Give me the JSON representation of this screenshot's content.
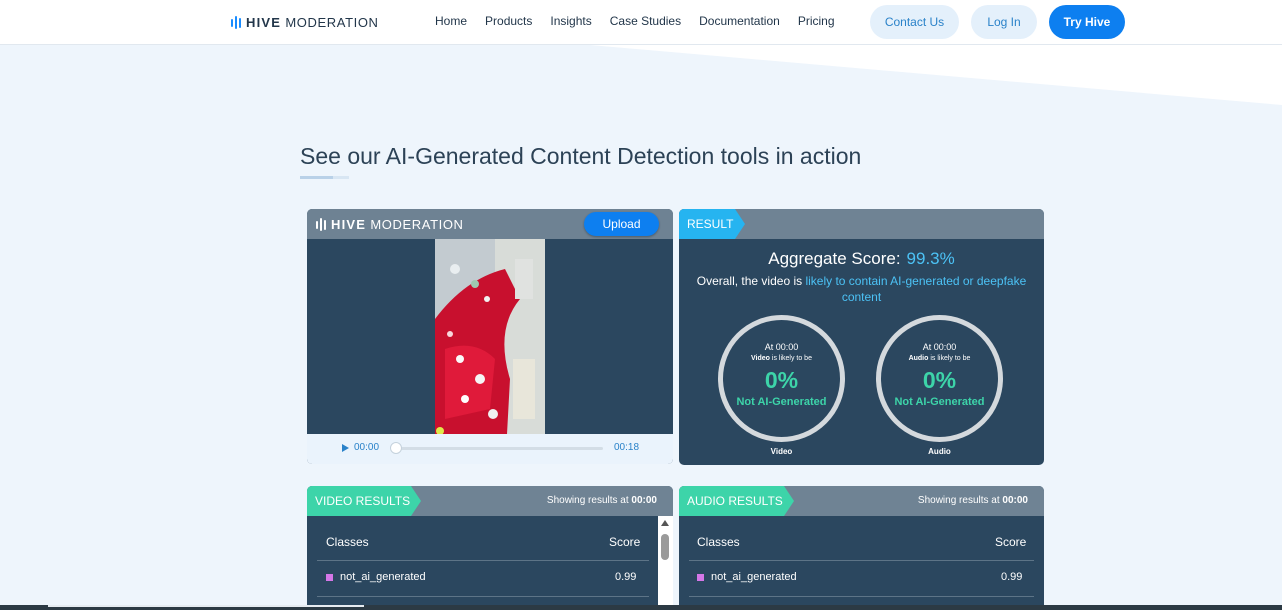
{
  "nav": {
    "logo_bold": "HIVE",
    "logo_light": "MODERATION",
    "links": [
      "Home",
      "Products",
      "Insights",
      "Case Studies",
      "Documentation",
      "Pricing"
    ],
    "contact_label": "Contact Us",
    "login_label": "Log In",
    "try_label": "Try Hive"
  },
  "section": {
    "heading": "See our AI-Generated Content Detection tools in action"
  },
  "player": {
    "logo_bold": "HIVE",
    "logo_light": "MODERATION",
    "upload_label": "Upload",
    "current_time": "00:00",
    "duration": "00:18",
    "progress": 0
  },
  "result": {
    "tag": "RESULT",
    "aggregate_label": "Aggregate Score:",
    "aggregate_value": "99.3%",
    "overall_prefix": "Overall, the video is ",
    "overall_highlight": "likely to contain AI-generated or deepfake content",
    "video_gauge": {
      "at": "At 00:00",
      "subject": "Video",
      "likely": " is likely to be",
      "percent": "0%",
      "verdict": "Not AI-Generated",
      "caption": "Video"
    },
    "audio_gauge": {
      "at": "At 00:00",
      "subject": "Audio",
      "likely": " is likely to be",
      "percent": "0%",
      "verdict": "Not AI-Generated",
      "caption": "Audio"
    }
  },
  "video_results": {
    "tag": "VIDEO RESULTS",
    "showing_prefix": "Showing results at ",
    "showing_time": "00:00",
    "col_classes": "Classes",
    "col_score": "Score",
    "rows": [
      {
        "class": "not_ai_generated",
        "score": "0.99",
        "color": "#d577e8"
      }
    ]
  },
  "audio_results": {
    "tag": "AUDIO RESULTS",
    "showing_prefix": "Showing results at ",
    "showing_time": "00:00",
    "col_classes": "Classes",
    "col_score": "Score",
    "rows": [
      {
        "class": "not_ai_generated",
        "score": "0.99",
        "color": "#d577e8"
      }
    ]
  },
  "colors": {
    "accent": "#0d7ff0",
    "panel": "#2b475f",
    "result_tag": "#26b4f0",
    "results_tag": "#3dd4a9",
    "highlight": "#4cc2f5"
  }
}
